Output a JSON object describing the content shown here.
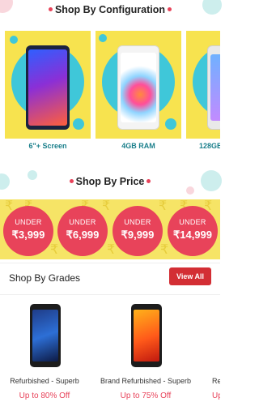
{
  "config_section": {
    "title": "Shop By Configuration",
    "cards": [
      {
        "label": "6\"+ Screen",
        "icon": "smartphone-icon"
      },
      {
        "label": "4GB RAM",
        "icon": "smartphone-icon"
      },
      {
        "label": "128GB",
        "icon": "smartphone-icon"
      }
    ]
  },
  "price_section": {
    "title": "Shop By Price",
    "badges": [
      {
        "prefix": "UNDER",
        "amount": "₹3,999"
      },
      {
        "prefix": "UNDER",
        "amount": "₹6,999"
      },
      {
        "prefix": "UNDER",
        "amount": "₹9,999"
      },
      {
        "prefix": "UNDER",
        "amount": "₹14,999"
      }
    ]
  },
  "grades_section": {
    "title": "Shop By Grades",
    "view_all_label": "View All",
    "cards": [
      {
        "name": "Refurbished - Superb",
        "offer": "Up to 80% Off"
      },
      {
        "name": "Brand Refurbished - Superb",
        "offer": "Up to 75% Off"
      },
      {
        "name": "Re",
        "offer": "Up"
      }
    ]
  },
  "colors": {
    "accent_pink": "#e8435a",
    "panel_yellow": "#f7e34f",
    "panel_teal": "#3fc7d9",
    "label_teal": "#1a7f8b",
    "button_red": "#d32e34"
  }
}
